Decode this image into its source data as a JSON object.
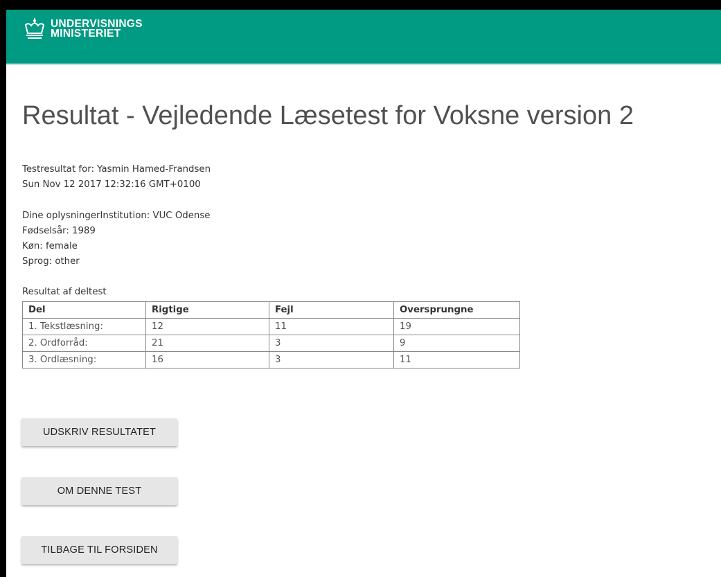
{
  "header": {
    "logo_line1": "UNDERVISNINGS",
    "logo_line2": "MINISTERIET",
    "logo_icon": "crown-icon",
    "brand_color": "#009b82"
  },
  "page": {
    "title": "Resultat - Vejledende Læsetest for Voksne version 2"
  },
  "result_header": {
    "testresult_for": "Testresultat for: Yasmin Hamed-Frandsen",
    "timestamp": "Sun Nov 12 2017 12:32:16 GMT+0100"
  },
  "personal_info": {
    "institution": "Dine oplysningerInstitution: VUC Odense",
    "birth_year": "Fødselsår: 1989",
    "gender": "Køn: female",
    "language": "Sprog: other"
  },
  "results_table": {
    "caption": "Resultat af deltest",
    "headers": [
      "Del",
      "Rigtige",
      "Fejl",
      "Oversprungne"
    ],
    "rows": [
      [
        "1. Tekstlæsning:",
        "12",
        "11",
        "19"
      ],
      [
        "2. Ordforråd:",
        "21",
        "3",
        "9"
      ],
      [
        "3. Ordlæsning:",
        "16",
        "3",
        "11"
      ]
    ]
  },
  "buttons": {
    "print": "UDSKRIV RESULTATET",
    "about": "OM DENNE TEST",
    "back": "TILBAGE TIL FORSIDEN"
  }
}
